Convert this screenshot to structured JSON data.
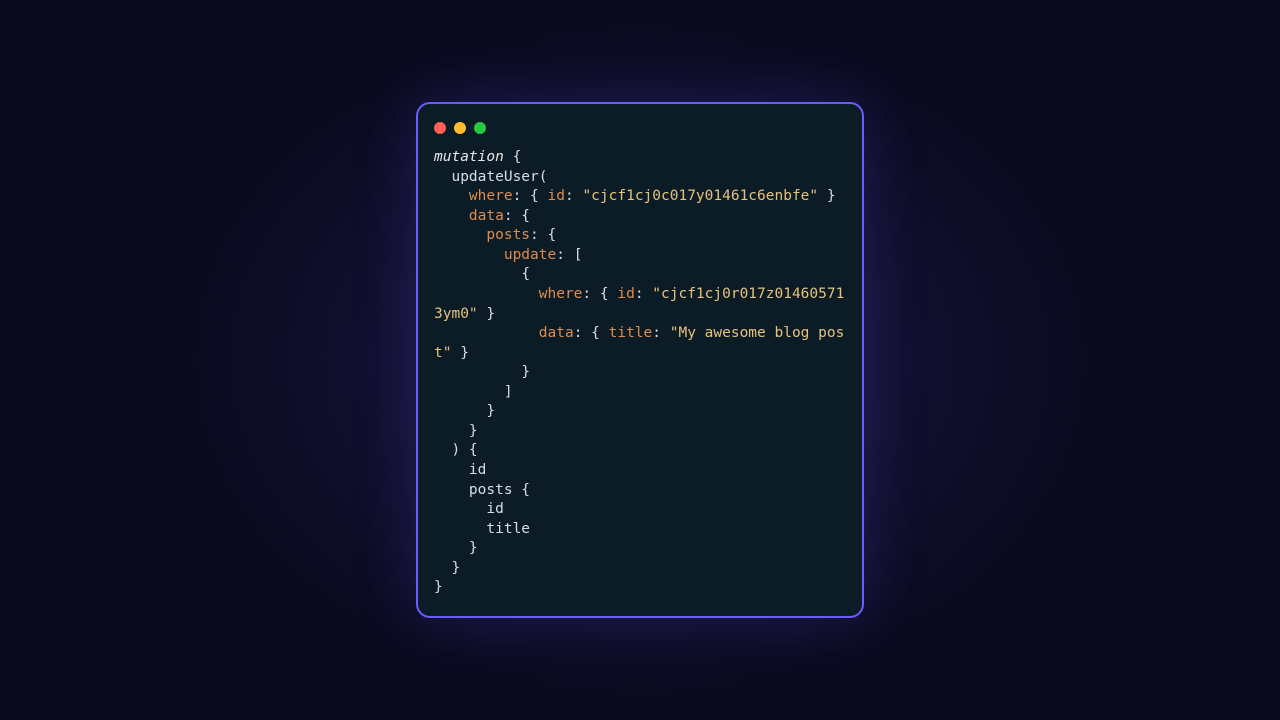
{
  "window": {
    "traffic": {
      "close": "close",
      "min": "minimize",
      "max": "maximize"
    }
  },
  "code": {
    "t_mutation": "mutation",
    "fn_updateUser": "updateUser",
    "arg_where": "where",
    "arg_id": "id",
    "str_userId": "\"cjcf1cj0c017y01461c6enbfe\"",
    "arg_data": "data",
    "arg_posts": "posts",
    "arg_update": "update",
    "str_postId": "\"cjcf1cj0r017z014605713ym0\"",
    "arg_title": "title",
    "str_title": "\"My awesome blog post\"",
    "sel_id": "id",
    "sel_posts": "posts",
    "sel_posts_id": "id",
    "sel_posts_title": "title"
  }
}
